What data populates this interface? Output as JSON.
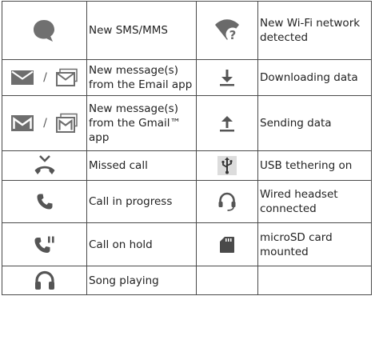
{
  "rows": [
    {
      "left": {
        "icon": "chat-bubble-icon",
        "text": "New SMS/MMS"
      },
      "right": {
        "icon": "wifi-question-icon",
        "text": "New Wi-Fi network\ndetected"
      }
    },
    {
      "left": {
        "icon": "email-envelope-icon",
        "separator": "/",
        "text": "New message(s)\nfrom the Email app"
      },
      "right": {
        "icon": "download-arrow-icon",
        "text": "Downloading data"
      }
    },
    {
      "left": {
        "icon": "gmail-icon",
        "separator": "/",
        "text": "New message(s)\nfrom the Gmail™\napp"
      },
      "right": {
        "icon": "upload-arrow-icon",
        "text": "Sending data"
      }
    },
    {
      "left": {
        "icon": "missed-call-icon",
        "text": "Missed call"
      },
      "right": {
        "icon": "usb-icon",
        "text": "USB tethering on"
      }
    },
    {
      "left": {
        "icon": "phone-handset-icon",
        "text": "Call in progress"
      },
      "right": {
        "icon": "headset-icon",
        "text": "Wired headset\nconnected"
      }
    },
    {
      "left": {
        "icon": "call-on-hold-icon",
        "text": "Call on hold"
      },
      "right": {
        "icon": "sd-card-icon",
        "text": "microSD card\nmounted"
      }
    },
    {
      "left": {
        "icon": "headphones-icon",
        "text": "Song playing"
      },
      "right": {
        "icon": "",
        "text": ""
      }
    }
  ]
}
